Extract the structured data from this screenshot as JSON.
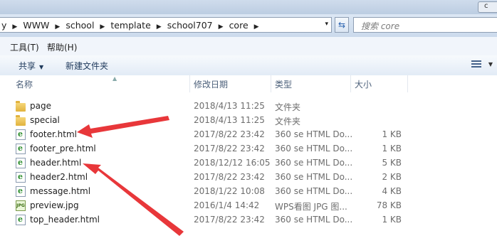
{
  "titlebar": {
    "tail_label": "c"
  },
  "address": {
    "crumbs": [
      "y",
      "WWW",
      "school",
      "template",
      "school707",
      "core"
    ],
    "dropdown_glyph": "▾"
  },
  "search": {
    "placeholder": "搜索 core"
  },
  "menu": {
    "items": [
      "工具(T)",
      "帮助(H)"
    ]
  },
  "commands": {
    "share": "共享",
    "new_folder": "新建文件夹"
  },
  "columns": {
    "name": "名称",
    "date": "修改日期",
    "type": "类型",
    "size": "大小"
  },
  "files": [
    {
      "name": "page",
      "date": "2018/4/13 11:25",
      "type": "文件夹",
      "size": "",
      "icon": "folder-icon"
    },
    {
      "name": "special",
      "date": "2018/4/13 11:25",
      "type": "文件夹",
      "size": "",
      "icon": "folder-icon"
    },
    {
      "name": "footer.html",
      "date": "2017/8/22 23:42",
      "type": "360 se HTML Do...",
      "size": "1 KB",
      "icon": "html-file-icon"
    },
    {
      "name": "footer_pre.html",
      "date": "2017/8/22 23:42",
      "type": "360 se HTML Do...",
      "size": "1 KB",
      "icon": "html-file-icon"
    },
    {
      "name": "header.html",
      "date": "2018/12/12 16:05",
      "type": "360 se HTML Do...",
      "size": "5 KB",
      "icon": "html-file-icon"
    },
    {
      "name": "header2.html",
      "date": "2017/8/22 23:42",
      "type": "360 se HTML Do...",
      "size": "2 KB",
      "icon": "html-file-icon"
    },
    {
      "name": "message.html",
      "date": "2018/1/22 10:08",
      "type": "360 se HTML Do...",
      "size": "4 KB",
      "icon": "html-file-icon"
    },
    {
      "name": "preview.jpg",
      "date": "2016/1/4 14:42",
      "type": "WPS看图 JPG 图...",
      "size": "78 KB",
      "icon": "jpg-file-icon"
    },
    {
      "name": "top_header.html",
      "date": "2017/8/22 23:42",
      "type": "360 se HTML Do...",
      "size": "1 KB",
      "icon": "html-file-icon"
    }
  ],
  "annotation_color": "#e8373a"
}
